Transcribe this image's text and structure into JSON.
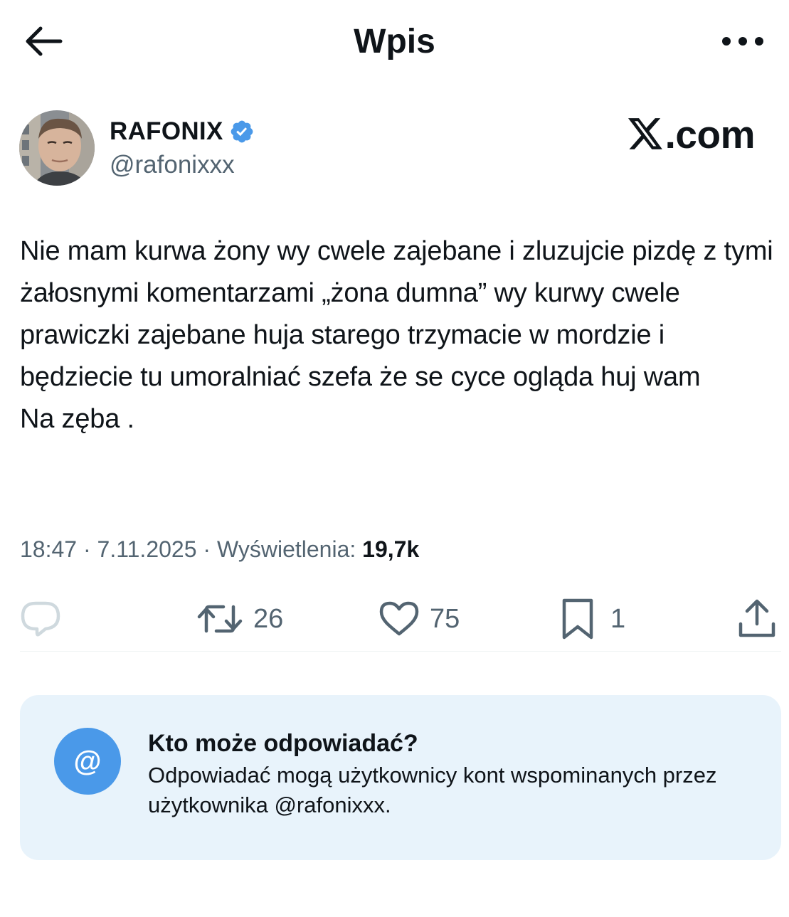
{
  "header": {
    "title": "Wpis",
    "back_icon": "arrow-left-icon",
    "more_icon": "more-horizontal-icon"
  },
  "author": {
    "name": "RAFONIX",
    "handle": "@rafonixxx",
    "verified": true,
    "verified_color": "#4a99e9"
  },
  "brand": {
    "text": ".com",
    "logo_icon": "x-logo-icon"
  },
  "tweet": {
    "text": "Nie mam kurwa żony wy cwele zajebane i zluzujcie pizdę z tymi żałosnymi komentarzami „żona dumna” wy kurwy cwele prawiczki zajebane huja starego trzymacie w mordzie i będziecie tu umoralniać szefa że se cyce ogląda huj wam\nNa zęba .",
    "time": "18:47",
    "date": "7.11.2025",
    "views_label": "Wyświetlenia:",
    "views_count": "19,7k"
  },
  "actions": {
    "reply": {
      "icon": "reply-icon",
      "count": ""
    },
    "retweet": {
      "icon": "retweet-icon",
      "count": "26"
    },
    "like": {
      "icon": "heart-icon",
      "count": "75"
    },
    "bookmark": {
      "icon": "bookmark-icon",
      "count": "1"
    },
    "share": {
      "icon": "share-icon"
    }
  },
  "reply_restriction": {
    "icon": "at-icon",
    "icon_text": "@",
    "title": "Kto może odpowiadać?",
    "description": "Odpowiadać mogą użytkownicy kont wspominanych przez użytkownika @rafonixxx.",
    "icon_color": "#4a99e9",
    "background": "#e8f3fb"
  },
  "colors": {
    "text_primary": "#0f1419",
    "text_secondary": "#536471"
  }
}
